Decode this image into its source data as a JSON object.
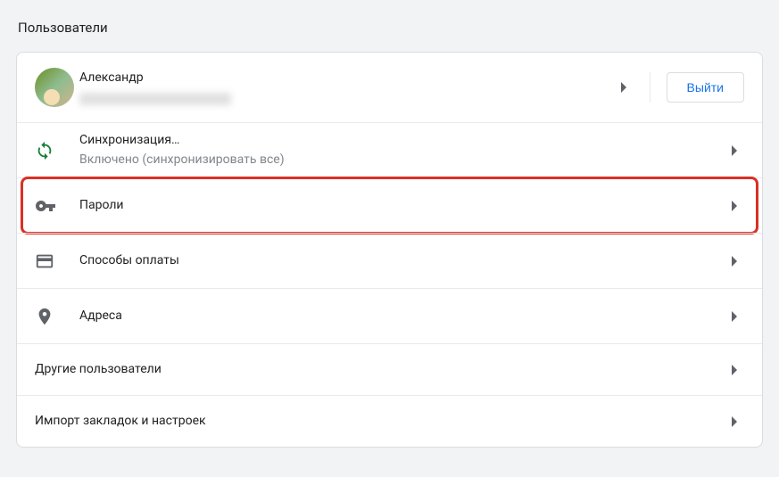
{
  "page": {
    "title": "Пользователи"
  },
  "profile": {
    "name": "Александр",
    "email_redacted": "redacted@example.com",
    "signout_label": "Выйти"
  },
  "rows": {
    "sync": {
      "title": "Синхронизация…",
      "sub": "Включено (синхронизировать все)"
    },
    "passwords": {
      "title": "Пароли"
    },
    "payment": {
      "title": "Способы оплаты"
    },
    "addresses": {
      "title": "Адреса"
    },
    "other_users": {
      "title": "Другие пользователи"
    },
    "import": {
      "title": "Импорт закладок и настроек"
    }
  },
  "highlight": "passwords"
}
